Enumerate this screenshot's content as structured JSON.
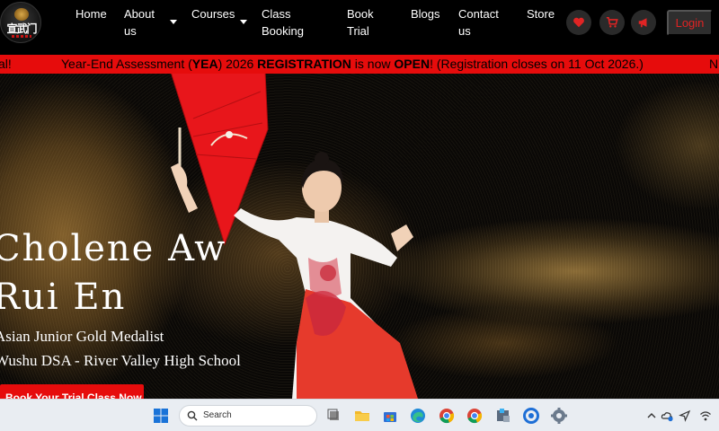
{
  "brand": {
    "logo_text": "宣武门"
  },
  "nav": {
    "items": [
      {
        "label": "Home"
      },
      {
        "label": "About us"
      },
      {
        "label": "Courses"
      },
      {
        "label": "Class Booking"
      },
      {
        "label": "Book Trial"
      },
      {
        "label": "Blogs"
      },
      {
        "label": "Contact us"
      },
      {
        "label": "Store"
      }
    ],
    "icons": [
      "heart-icon",
      "cart-icon",
      "megaphone-icon"
    ],
    "login_label": "Login"
  },
  "announcement": {
    "prev_tail": "al!",
    "part1": "Year-End Assessment (",
    "part2": "YEA",
    "part3": ") 2026 ",
    "part4": "REGISTRATION",
    "part5": " is now ",
    "part6": "OPEN",
    "part7": "! (Registration closes on 11 Oct 2026.)",
    "next_head": "N"
  },
  "hero": {
    "title_line1": "Cholene Aw",
    "title_line2": "Rui En",
    "subtitle_line1": "Asian Junior Gold Medalist",
    "subtitle_line2": "Wushu DSA - River Valley High School",
    "cta_label": "Book Your Trial Class Now"
  },
  "taskbar": {
    "search_placeholder": "Search",
    "apps": [
      "windows-start-icon",
      "task-view-icon",
      "file-explorer-icon",
      "store-icon",
      "edge-icon",
      "chrome-icon",
      "chrome-profile-icon",
      "app-icon",
      "security-icon",
      "settings-icon"
    ]
  },
  "colors": {
    "accent": "#e60c0c",
    "navbar_bg": "#000000",
    "taskbar_bg": "#e9edf2"
  }
}
